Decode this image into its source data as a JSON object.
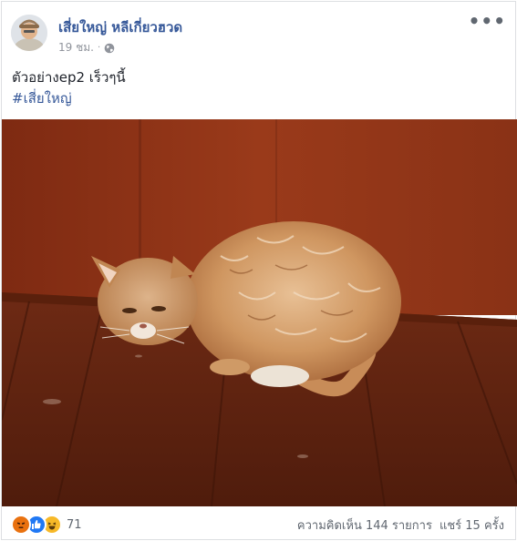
{
  "post": {
    "author": "เสี่ยใหญ่ หลีเกี่ยวฮวด",
    "time": "19 ชม.",
    "privacy_icon": "globe-icon",
    "text": "ตัวอย่างep2 เร็วๆนี้",
    "hashtag": "#เสี่ยใหญ่",
    "more_label": "•••"
  },
  "reactions": {
    "icons": [
      "angry-icon",
      "like-icon",
      "haha-icon"
    ],
    "count": "71"
  },
  "stats": {
    "comments": "ความคิดเห็น 144 รายการ",
    "shares": "แชร์ 15 ครั้ง"
  },
  "colors": {
    "link": "#365899",
    "meta": "#90949c",
    "like": "#2078f4",
    "angry": "#e9710f",
    "haha": "#f7b928"
  }
}
